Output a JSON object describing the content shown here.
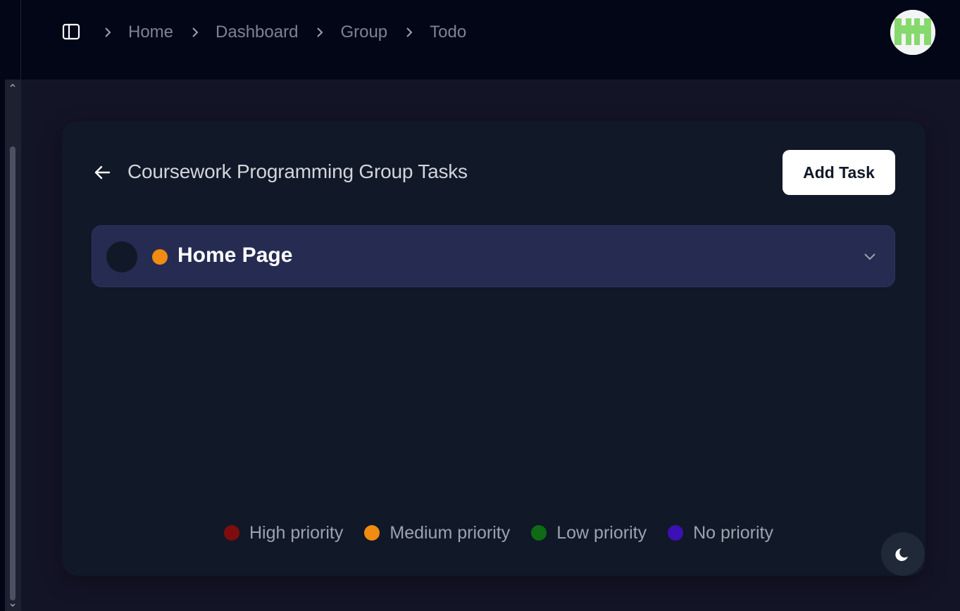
{
  "breadcrumb": {
    "items": [
      "Home",
      "Dashboard",
      "Group",
      "Todo"
    ]
  },
  "page": {
    "title": "Coursework Programming Group Tasks",
    "add_task_label": "Add Task"
  },
  "tasks": [
    {
      "name": "Home Page",
      "priority": "Medium priority",
      "priority_color": "#f08c11"
    }
  ],
  "legend": [
    {
      "label": "High priority",
      "color": "#7f0d0d"
    },
    {
      "label": "Medium priority",
      "color": "#f08c11"
    },
    {
      "label": "Low priority",
      "color": "#0f6b16"
    },
    {
      "label": "No priority",
      "color": "#3b10b5"
    }
  ],
  "icons": {
    "sidebar_toggle": "sidebar-panel-icon",
    "breadcrumb_separator": "chevron-right-icon",
    "back": "arrow-left-icon",
    "expand": "chevron-down-icon",
    "theme": "moon-icon",
    "avatar": "pixel-identicon"
  },
  "colors": {
    "accent_avatar": "#86d96c",
    "background": "#141427",
    "card": "#111827",
    "task_row": "#262b52"
  }
}
